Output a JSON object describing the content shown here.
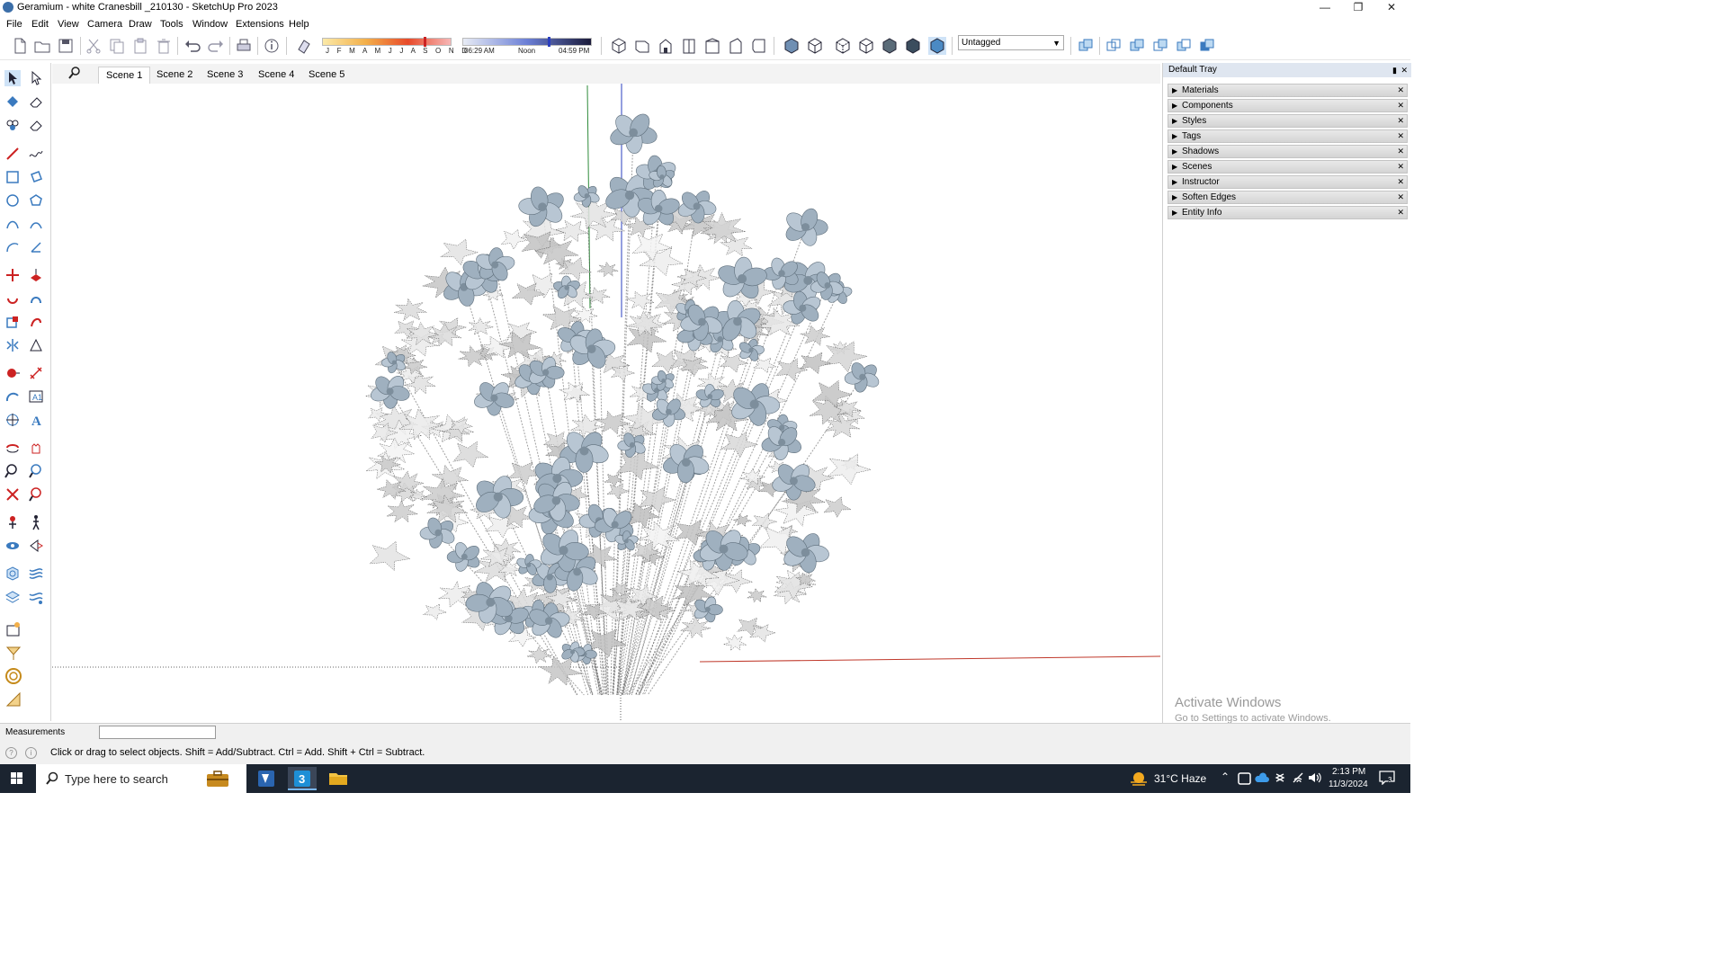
{
  "window": {
    "title": "Geramium - white Cranesbill _210130 - SketchUp Pro 2023",
    "app_icon": "sketchup-icon",
    "controls": [
      "minimize-icon",
      "restore-icon",
      "close-icon"
    ]
  },
  "menu": [
    "File",
    "Edit",
    "View",
    "Camera",
    "Draw",
    "Tools",
    "Window",
    "Extensions",
    "Help"
  ],
  "toolbar": {
    "months": "J F M A M J J A S O N D",
    "time_start": "06:29 AM",
    "time_mid": "Noon",
    "time_end": "04:59 PM",
    "tag_value": "Untagged"
  },
  "scenes": {
    "tabs": [
      "Scene 1",
      "Scene 2",
      "Scene 3",
      "Scene 4",
      "Scene 5"
    ],
    "active": "Scene 1"
  },
  "tray": {
    "title": "Default Tray",
    "panels": [
      "Materials",
      "Components",
      "Styles",
      "Tags",
      "Shadows",
      "Scenes",
      "Instructor",
      "Soften Edges",
      "Entity Info"
    ],
    "watermark_line1": "Activate Windows",
    "watermark_line2": "Go to Settings to activate Windows."
  },
  "measurements": {
    "label": "Measurements",
    "value": ""
  },
  "status": {
    "text": "Click or drag to select objects. Shift = Add/Subtract. Ctrl = Add. Shift + Ctrl = Subtract."
  },
  "taskbar": {
    "search_placeholder": "Type here to search",
    "weather": "31°C  Haze",
    "time": "2:13 PM",
    "date": "11/3/2024",
    "notification_count": "3"
  },
  "colors": {
    "flower_fill": "#b8c6d3",
    "flower_dark": "#5f6f7c",
    "axis_red": "#c0392b",
    "axis_green": "#2e8b3a",
    "axis_blue": "#2a3fbf",
    "taskbar_bg": "#1b2430"
  }
}
